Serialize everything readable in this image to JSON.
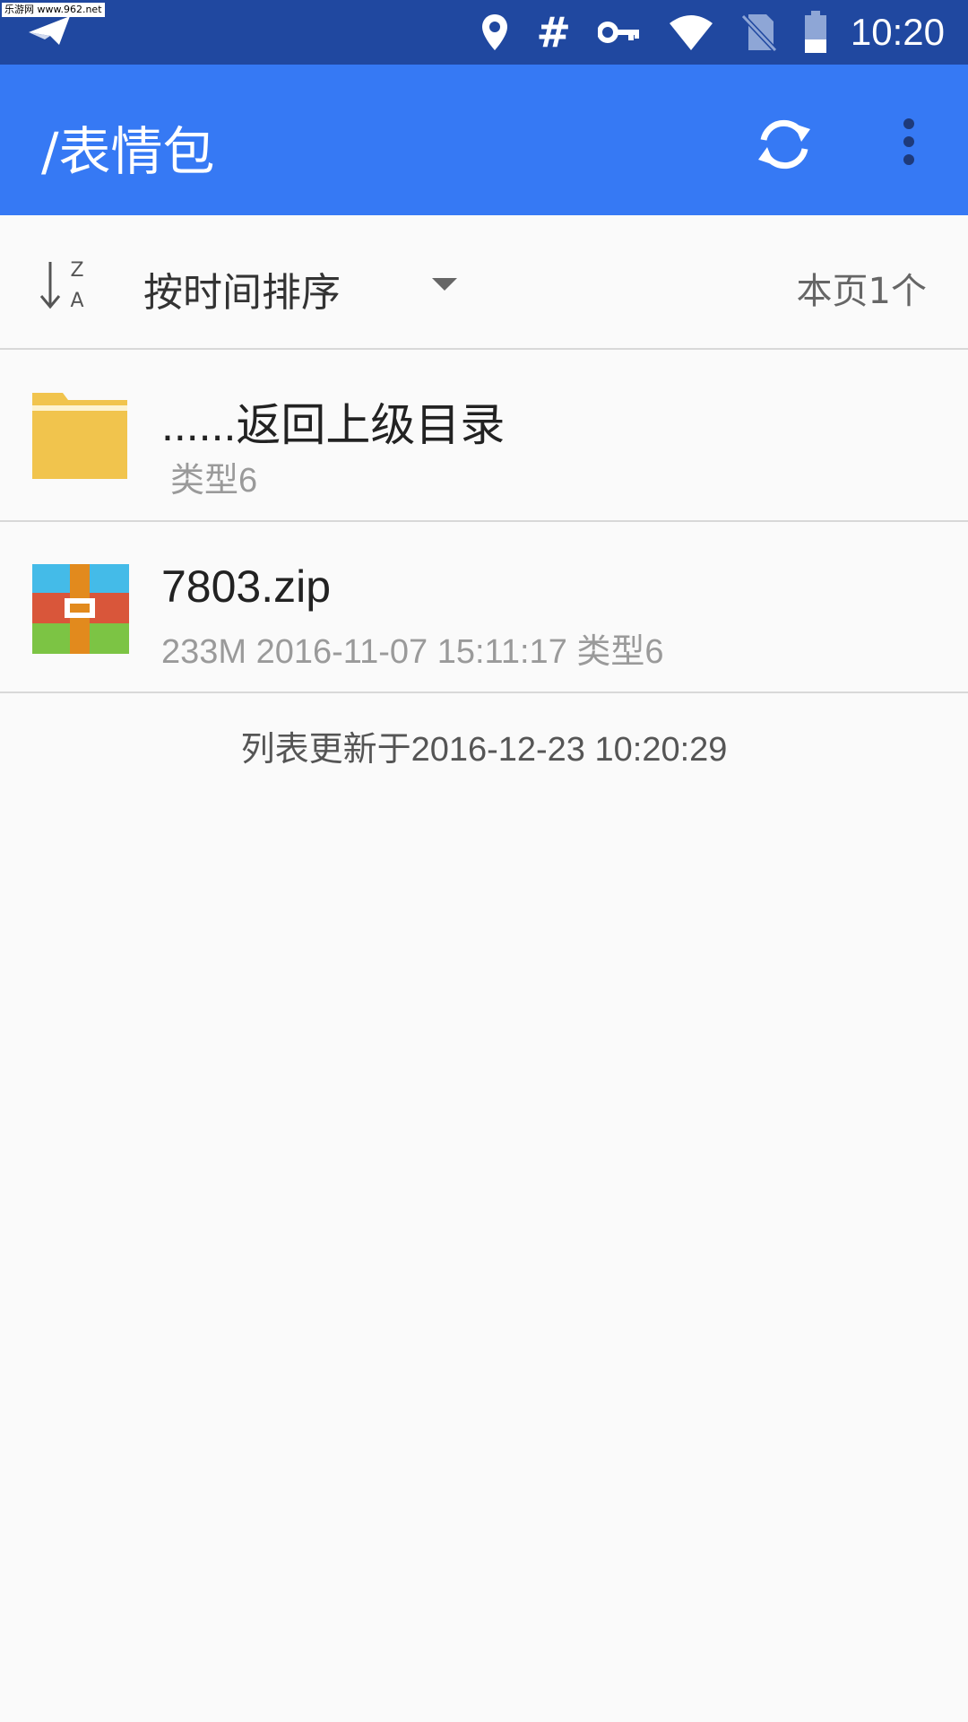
{
  "status_bar": {
    "watermark": "乐游网 www.962.net",
    "time": "10:20",
    "icons": [
      "send-icon",
      "location-icon",
      "hash-icon",
      "key-icon",
      "wifi-icon",
      "no-sim-icon",
      "battery-icon"
    ],
    "hash_glyph": "#"
  },
  "app_bar": {
    "title": "/表情包",
    "actions": [
      "refresh-icon",
      "more-vert-icon"
    ],
    "color": "#3679f4"
  },
  "sort_bar": {
    "sort_label": "按时间排序",
    "sort_icon_top": "Z",
    "sort_icon_bottom": "A",
    "page_count": "本页1个"
  },
  "files": [
    {
      "name": "......返回上级目录",
      "meta": "类型6",
      "icon": "folder-icon"
    },
    {
      "name": "7803.zip",
      "meta": "233M 2016-11-07 15:11:17 类型6",
      "icon": "zip-archive-icon"
    }
  ],
  "footer": {
    "updated_text": "列表更新于2016-12-23 10:20:29"
  }
}
